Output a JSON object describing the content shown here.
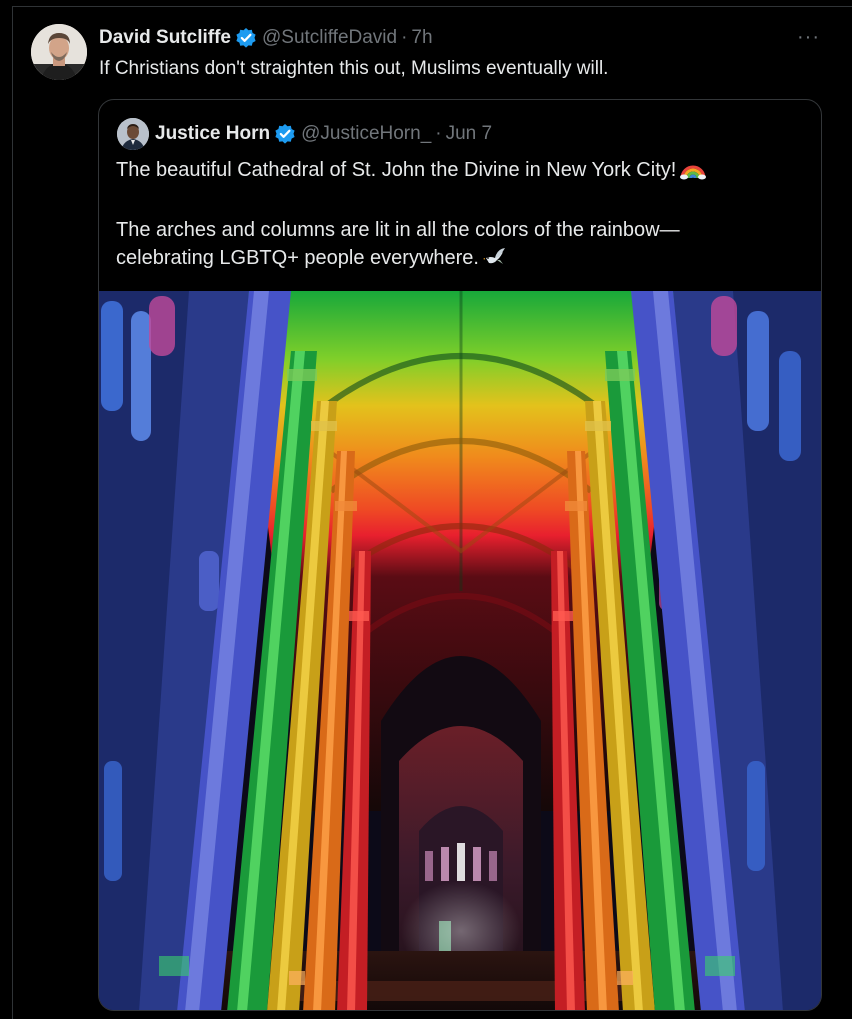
{
  "tweet": {
    "author_name": "David Sutcliffe",
    "handle": "@SutcliffeDavid",
    "separator": "·",
    "time": "7h",
    "text": "If Christians don't straighten this out, Muslims eventually will.",
    "more_label": "···"
  },
  "quote": {
    "author_name": "Justice Horn",
    "handle": "@JusticeHorn_",
    "separator": "·",
    "time": "Jun 7",
    "line1": "The beautiful Cathedral of St. John the Divine in New York City!",
    "line2": "The arches and columns are lit in all the colors of the rainbow—",
    "line3": "celebrating LGBTQ+ people everywhere.",
    "emoji_1": "rainbow-icon",
    "emoji_2": "dove-icon"
  },
  "colors": {
    "background": "#000000",
    "text_primary": "#e7e9ea",
    "text_secondary": "#71767b",
    "verified_blue": "#1d9bf0",
    "border": "#2f3336"
  }
}
